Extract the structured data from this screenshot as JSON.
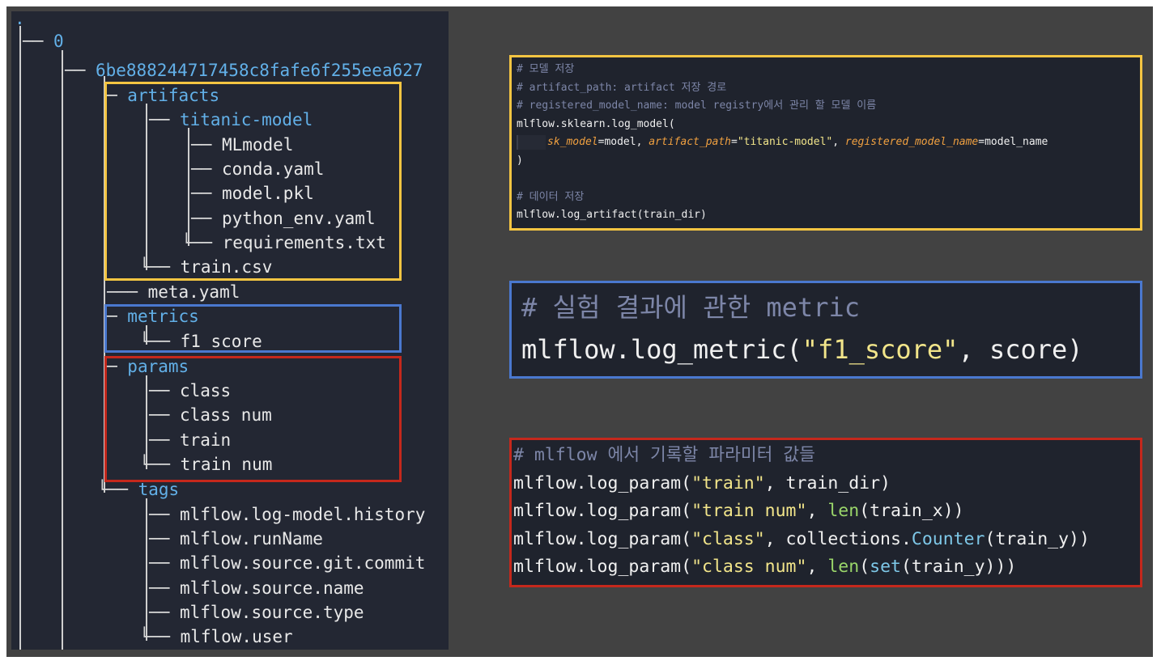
{
  "tree": {
    "root": ".",
    "nodes": [
      {
        "connector": "── ",
        "name": "0",
        "dir": true
      },
      {
        "connector": "── ",
        "name": "6be888244717458c8fafe6f255eea627",
        "dir": true
      },
      {
        "connector": "─ ",
        "name": "artifacts",
        "dir": true
      },
      {
        "connector": "── ",
        "name": "titanic-model",
        "dir": true
      },
      {
        "connector": "── ",
        "name": "MLmodel",
        "dir": false
      },
      {
        "connector": "── ",
        "name": "conda.yaml",
        "dir": false
      },
      {
        "connector": "── ",
        "name": "model.pkl",
        "dir": false
      },
      {
        "connector": "── ",
        "name": "python_env.yaml",
        "dir": false
      },
      {
        "connector": "└── ",
        "name": "requirements.txt",
        "dir": false
      },
      {
        "connector": "└── ",
        "name": "train.csv",
        "dir": false
      },
      {
        "connector": "─── ",
        "name": "meta.yaml",
        "dir": false
      },
      {
        "connector": "─ ",
        "name": "metrics",
        "dir": true
      },
      {
        "connector": "└── ",
        "name": "f1 score",
        "dir": false
      },
      {
        "connector": "─ ",
        "name": "params",
        "dir": true
      },
      {
        "connector": "── ",
        "name": "class",
        "dir": false
      },
      {
        "connector": "── ",
        "name": "class num",
        "dir": false
      },
      {
        "connector": "── ",
        "name": "train",
        "dir": false
      },
      {
        "connector": "└── ",
        "name": "train num",
        "dir": false
      },
      {
        "connector": "└── ",
        "name": "tags",
        "dir": true
      },
      {
        "connector": "── ",
        "name": "mlflow.log-model.history",
        "dir": false
      },
      {
        "connector": "── ",
        "name": "mlflow.runName",
        "dir": false
      },
      {
        "connector": "── ",
        "name": "mlflow.source.git.commit",
        "dir": false
      },
      {
        "connector": "── ",
        "name": "mlflow.source.name",
        "dir": false
      },
      {
        "connector": "── ",
        "name": "mlflow.source.type",
        "dir": false
      },
      {
        "connector": "└── ",
        "name": "mlflow.user",
        "dir": false
      }
    ]
  },
  "code_model": {
    "lines": [
      [
        {
          "t": "# 모델 저장",
          "c": "cmt"
        }
      ],
      [
        {
          "t": "# artifact_path: artifact 저장 경로",
          "c": "cmt"
        }
      ],
      [
        {
          "t": "# registered_model_name: model registry에서 관리 할 모델 이름",
          "c": "cmt"
        }
      ],
      [
        {
          "t": "mlflow.sklearn.log_model(",
          "c": "pun"
        }
      ],
      [
        {
          "t": "",
          "c": "indent"
        },
        {
          "t": "sk_model",
          "c": "kw"
        },
        {
          "t": "=model, ",
          "c": "pun"
        },
        {
          "t": "artifact_path",
          "c": "kw"
        },
        {
          "t": "=",
          "c": "pun"
        },
        {
          "t": "\"titanic-model\"",
          "c": "str"
        },
        {
          "t": ", ",
          "c": "pun"
        },
        {
          "t": "registered_model_name",
          "c": "kw"
        },
        {
          "t": "=model_name",
          "c": "pun"
        }
      ],
      [
        {
          "t": ")",
          "c": "pun"
        }
      ],
      [
        {
          "t": "",
          "c": "pun"
        }
      ],
      [
        {
          "t": "# 데이터 저장",
          "c": "cmt"
        }
      ],
      [
        {
          "t": "mlflow.log_artifact(train_dir)",
          "c": "pun"
        }
      ]
    ]
  },
  "code_metric": {
    "lines": [
      [
        {
          "t": "# 실험 결과에 관한 metric",
          "c": "cmt"
        }
      ],
      [
        {
          "t": "mlflow.log_metric(",
          "c": "pun"
        },
        {
          "t": "\"f1_score\"",
          "c": "str"
        },
        {
          "t": ", score)",
          "c": "pun"
        }
      ]
    ]
  },
  "code_params": {
    "lines": [
      [
        {
          "t": "# mlflow 에서 기록할 파라미터 값들",
          "c": "cmt"
        }
      ],
      [
        {
          "t": "mlflow.log_param(",
          "c": "pun"
        },
        {
          "t": "\"train\"",
          "c": "str"
        },
        {
          "t": ", train_dir)",
          "c": "pun"
        }
      ],
      [
        {
          "t": "mlflow.log_param(",
          "c": "pun"
        },
        {
          "t": "\"train num\"",
          "c": "str"
        },
        {
          "t": ", ",
          "c": "pun"
        },
        {
          "t": "len",
          "c": "fn"
        },
        {
          "t": "(train_x))",
          "c": "pun"
        }
      ],
      [
        {
          "t": "mlflow.log_param(",
          "c": "pun"
        },
        {
          "t": "\"class\"",
          "c": "str"
        },
        {
          "t": ", collections.",
          "c": "pun"
        },
        {
          "t": "Counter",
          "c": "cls"
        },
        {
          "t": "(train_y))",
          "c": "pun"
        }
      ],
      [
        {
          "t": "mlflow.log_param(",
          "c": "pun"
        },
        {
          "t": "\"class num\"",
          "c": "str"
        },
        {
          "t": ", ",
          "c": "pun"
        },
        {
          "t": "len",
          "c": "fn"
        },
        {
          "t": "(",
          "c": "pun"
        },
        {
          "t": "set",
          "c": "cls"
        },
        {
          "t": "(train_y)))",
          "c": "pun"
        }
      ]
    ]
  },
  "colors": {
    "panel_bg": "#232733",
    "backdrop": "#424242",
    "highlight_artifacts": "#f4c542",
    "highlight_metrics": "#4a78cf",
    "highlight_params": "#c5281c",
    "directory_name": "#62b0e8",
    "string": "#f2e58a",
    "comment": "#7d86a8"
  }
}
